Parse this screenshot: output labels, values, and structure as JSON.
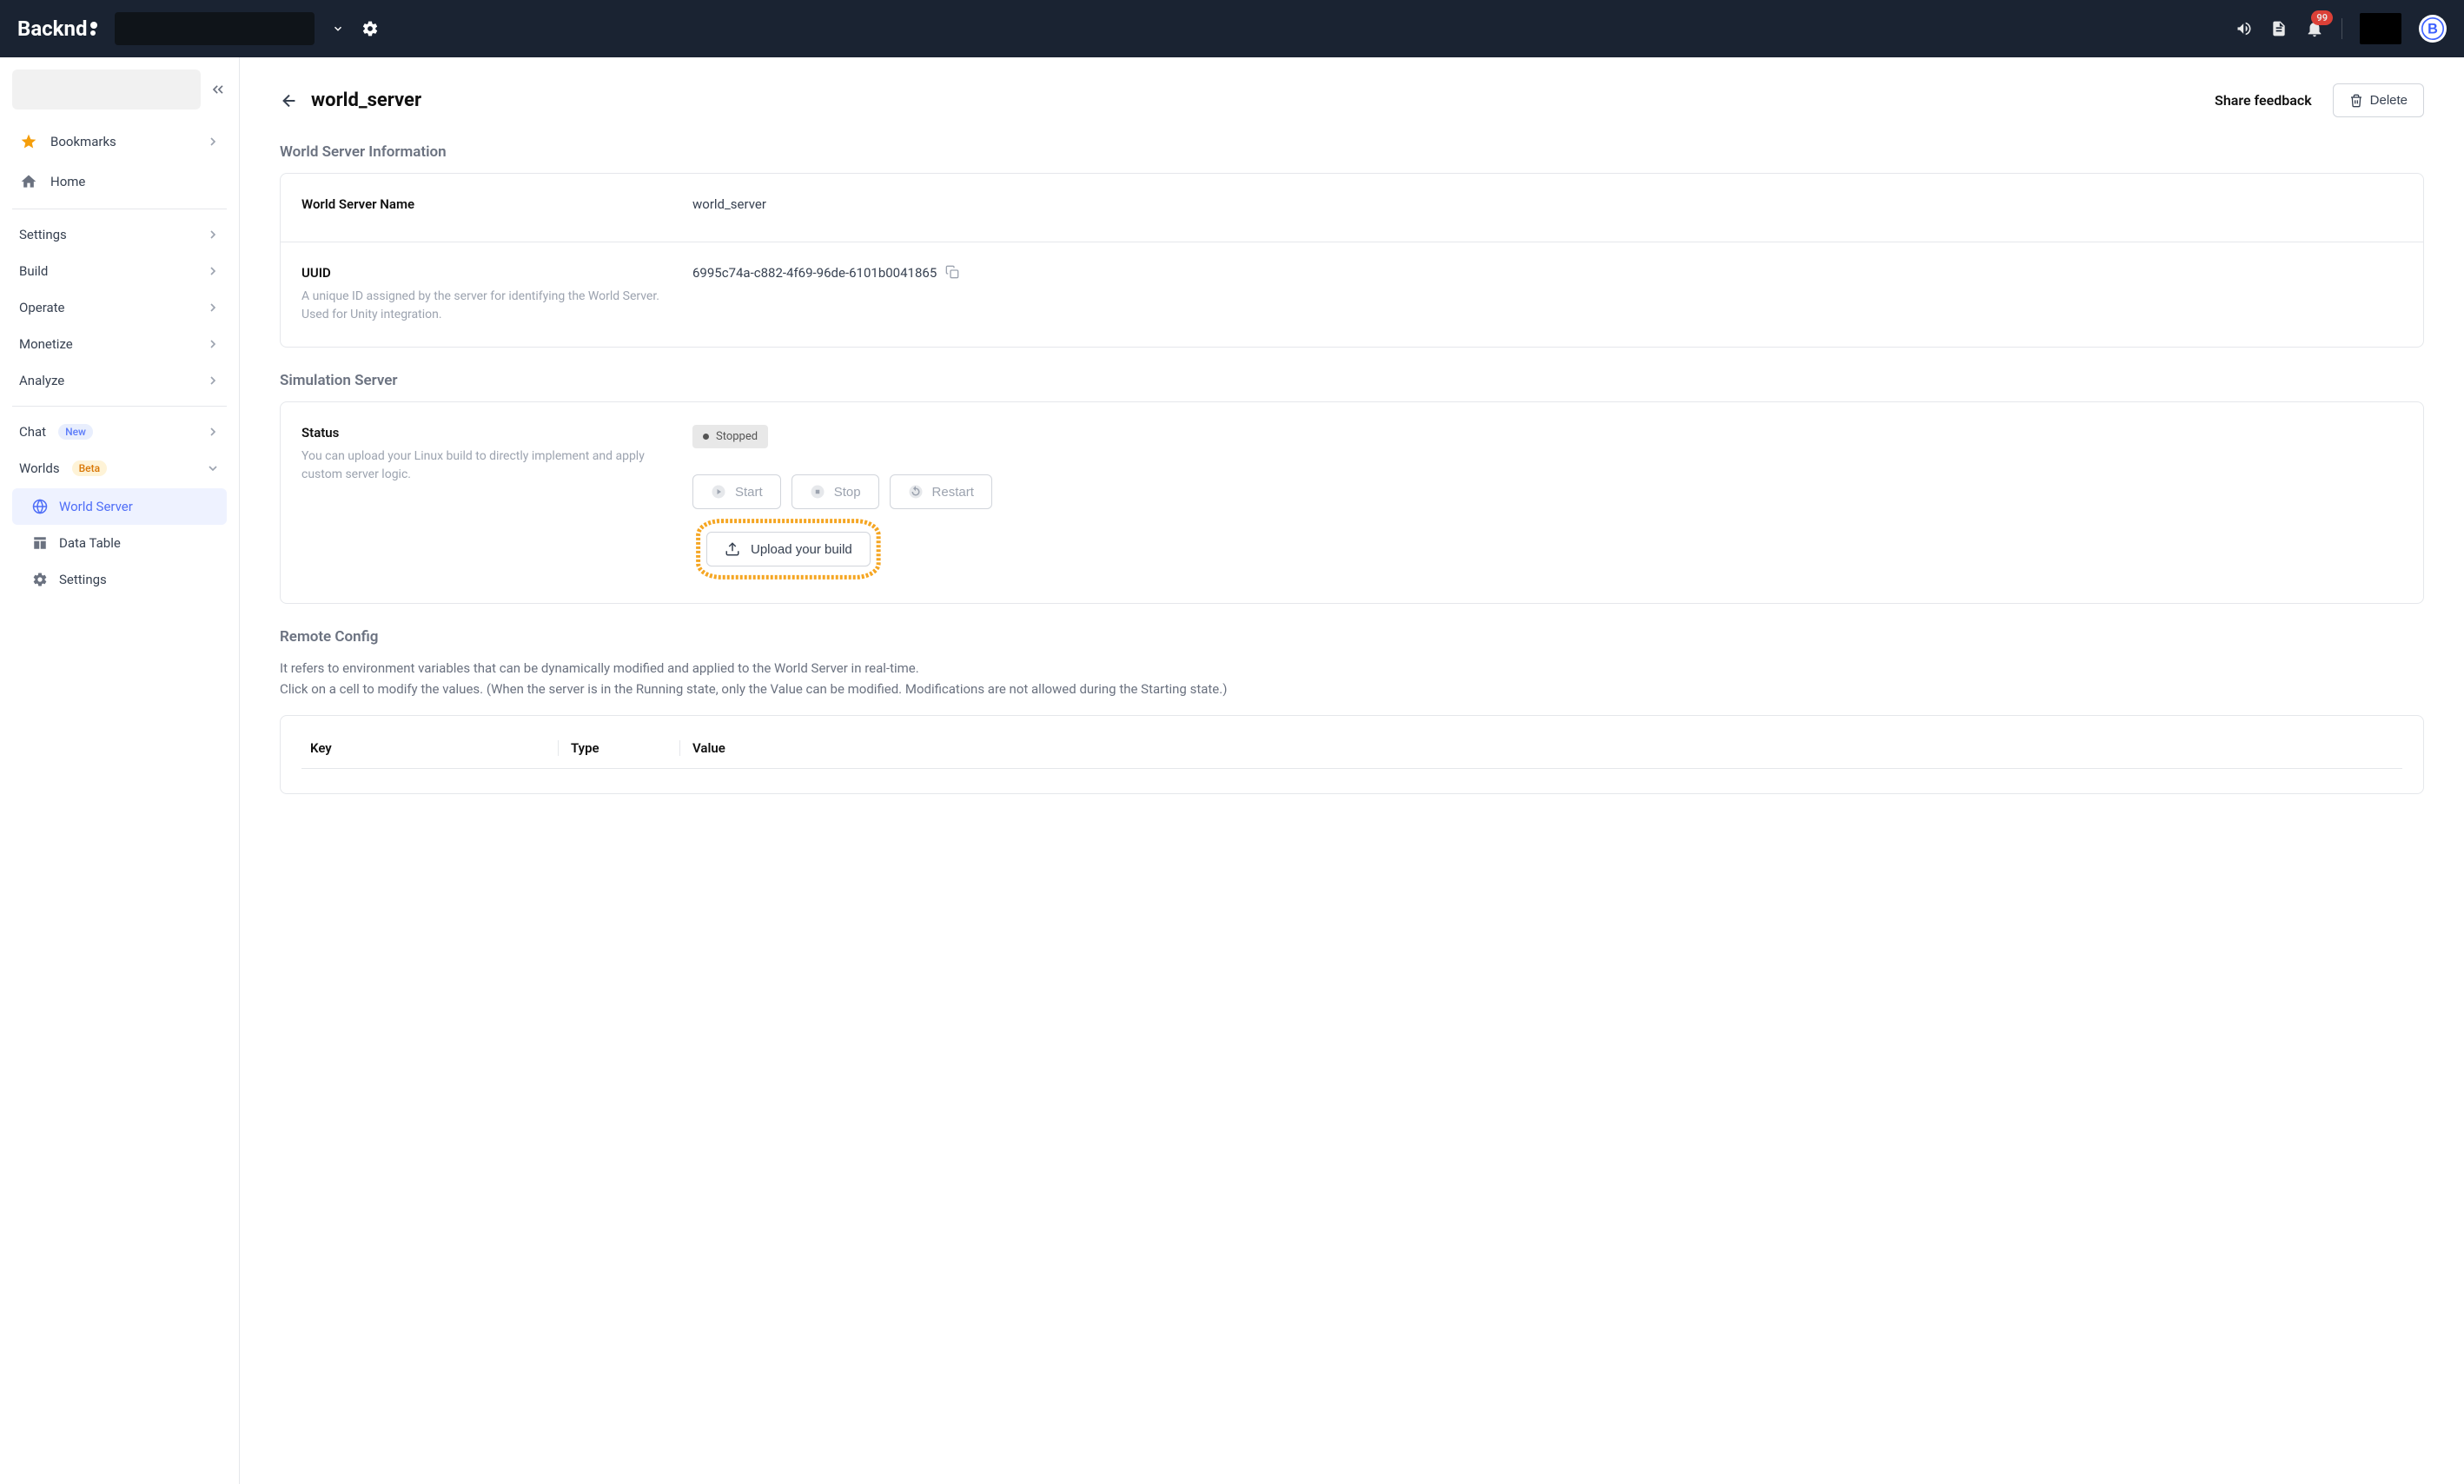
{
  "header": {
    "logo_text": "Backnd",
    "notif_count": "99"
  },
  "sidebar": {
    "bookmarks_label": "Bookmarks",
    "home_label": "Home",
    "settings_label": "Settings",
    "build_label": "Build",
    "operate_label": "Operate",
    "monetize_label": "Monetize",
    "analyze_label": "Analyze",
    "chat_label": "Chat",
    "chat_badge": "New",
    "worlds_label": "Worlds",
    "worlds_badge": "Beta",
    "sub_world_server": "World Server",
    "sub_data_table": "Data Table",
    "sub_settings": "Settings"
  },
  "page": {
    "title": "world_server",
    "share_label": "Share feedback",
    "delete_label": "Delete"
  },
  "info": {
    "heading": "World Server Information",
    "name_label": "World Server Name",
    "name_value": "world_server",
    "uuid_label": "UUID",
    "uuid_desc": "A unique ID assigned by the server for identifying the World Server. Used for Unity integration.",
    "uuid_value": "6995c74a-c882-4f69-96de-6101b0041865"
  },
  "sim": {
    "heading": "Simulation Server",
    "status_label": "Status",
    "status_desc": "You can upload your Linux build to directly implement and apply custom server logic.",
    "status_value": "Stopped",
    "start_label": "Start",
    "stop_label": "Stop",
    "restart_label": "Restart",
    "upload_label": "Upload your build"
  },
  "remote": {
    "heading": "Remote Config",
    "desc_line1": "It refers to environment variables that can be dynamically modified and applied to the World Server in real-time.",
    "desc_line2": "Click on a cell to modify the values. (When the server is in the Running state, only the Value can be modified. Modifications are not allowed during the Starting state.)",
    "th_key": "Key",
    "th_type": "Type",
    "th_value": "Value"
  }
}
